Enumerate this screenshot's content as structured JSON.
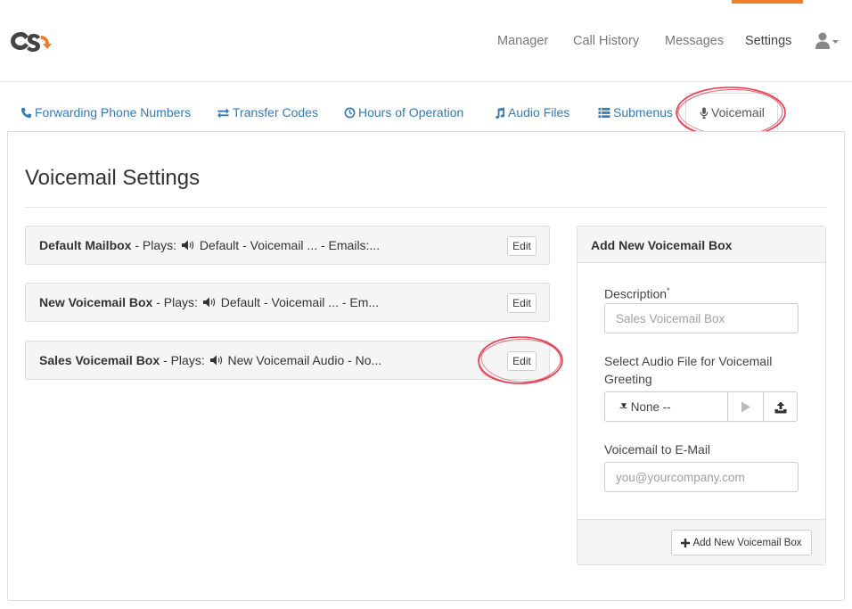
{
  "nav": {
    "items": [
      {
        "label": "Manager"
      },
      {
        "label": "Call History"
      },
      {
        "label": "Messages"
      },
      {
        "label": "Settings"
      }
    ],
    "active": "Settings",
    "accent_color": "#f07d2c",
    "user_icon": "user-icon"
  },
  "subtabs": [
    {
      "label": "Forwarding Phone Numbers",
      "icon": "phone-icon"
    },
    {
      "label": "Transfer Codes",
      "icon": "exchange-icon"
    },
    {
      "label": "Hours of Operation",
      "icon": "clock-icon"
    },
    {
      "label": "Audio Files",
      "icon": "music-icon"
    },
    {
      "label": "Submenus",
      "icon": "list-icon"
    },
    {
      "label": "Voicemail",
      "icon": "microphone-icon"
    }
  ],
  "page": {
    "title": "Voicemail Settings"
  },
  "mailboxes": [
    {
      "name": "Default Mailbox",
      "rest_a": " - Plays: ",
      "rest_b": " Default - Voicemail ... - Emails:...",
      "edit_label": "Edit"
    },
    {
      "name": "New Voicemail Box",
      "rest_a": " - Plays: ",
      "rest_b": " Default - Voicemail ... - Em...",
      "edit_label": "Edit"
    },
    {
      "name": "Sales Voicemail Box",
      "rest_a": " - Plays: ",
      "rest_b": " New Voicemail Audio - No...",
      "edit_label": "Edit"
    }
  ],
  "form": {
    "heading": "Add New Voicemail Box",
    "description_label": "Description",
    "required_mark": "*",
    "description_placeholder": "Sales Voicemail Box",
    "audio_label": "Select Audio File for Voicemail Greeting",
    "audio_selected": "-- None --",
    "email_label": "Voicemail to E-Mail",
    "email_placeholder": "you@yourcompany.com",
    "submit_label": "Add New Voicemail Box"
  },
  "annotation_color": "#e0293d"
}
